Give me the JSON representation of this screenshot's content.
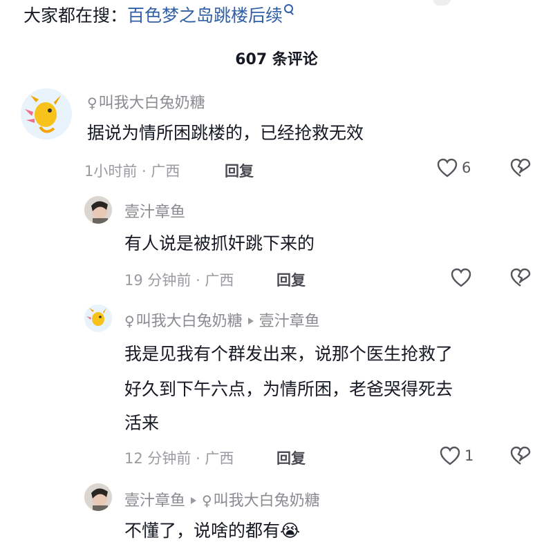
{
  "header": {
    "search_prefix": "大家都在搜：",
    "search_term": "百色梦之岛跳楼后续",
    "comment_count": "607 条评论"
  },
  "comments": [
    {
      "username": "叫我大白兔奶糖",
      "text": "据说为情所困跳楼的，已经抢救无效",
      "time": "1小时前 · 广西",
      "reply": "回复",
      "likes": "6"
    },
    {
      "username": "壹汁章鱼",
      "text": "有人说是被抓奸跳下来的",
      "time": "19 分钟前 · 广西",
      "reply": "回复",
      "likes": ""
    },
    {
      "username": "叫我大白兔奶糖",
      "reply_to": "壹汁章鱼",
      "text_line1": "我是见我有个群发出来，说那个医生抢救了",
      "text_line2": "好久到下午六点，为情所困，老爸哭得死去",
      "text_line3": "活来",
      "time": "12 分钟前 · 广西",
      "reply": "回复",
      "likes": "1"
    },
    {
      "username": "壹汁章鱼",
      "reply_to": "叫我大白兔奶糖",
      "text": "不懂了，说啥的都有",
      "emoji": "😭"
    }
  ],
  "colors": {
    "link_blue": "#2f5fa8",
    "meta_gray": "#9a9ba0",
    "text_dark": "#161823"
  }
}
